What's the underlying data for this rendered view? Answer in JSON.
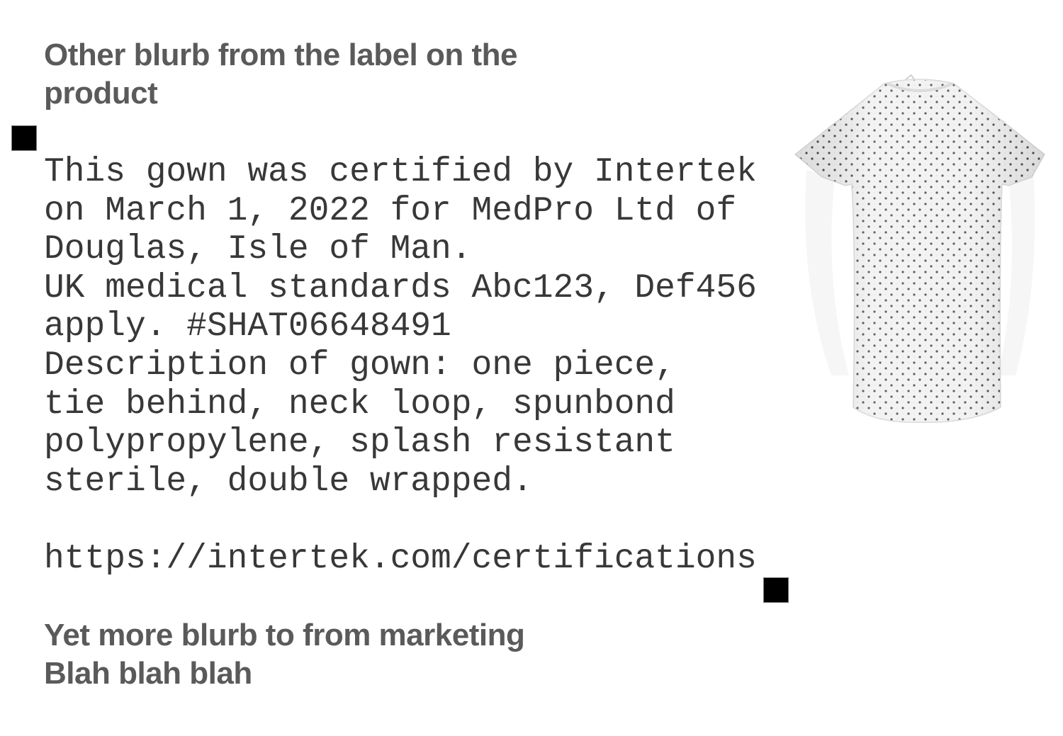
{
  "label_blurb": {
    "heading_line1": "Other blurb from the label on the",
    "heading_line2": "product"
  },
  "certification": {
    "lines": [
      "This gown was certified by Intertek",
      "on March 1, 2022 for MedPro Ltd of",
      "Douglas, Isle of Man.",
      "UK medical standards Abc123, Def456",
      "apply. #SHAT06648491",
      "Description of gown: one piece,",
      "tie behind, neck loop, spunbond",
      "polypropylene, splash resistant",
      "sterile, double wrapped."
    ],
    "url": "https://intertek.com/certifications"
  },
  "marketing_blurb": {
    "line1": "Yet more blurb to from marketing",
    "line2": "Blah blah blah"
  },
  "colors": {
    "heading": "#5a5a5a",
    "body_text": "#383838",
    "marker": "#000000",
    "gown_fabric": "#f1f1f1",
    "gown_dots": "#4a4a4a"
  },
  "icons": {
    "markers": "black-square-icon"
  }
}
